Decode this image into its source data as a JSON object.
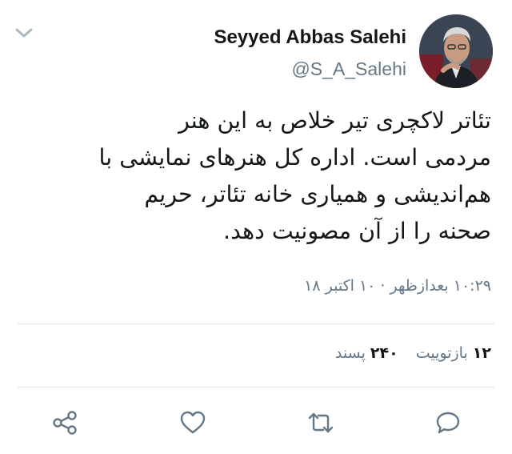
{
  "header": {
    "display_name": "Seyyed Abbas Salehi",
    "handle": "@S_A_Salehi",
    "menu_icon": "chevron-down-icon",
    "avatar": "profile-photo"
  },
  "tweet": {
    "lines": [
      "تئاتر لاکچری تیر خلاص به این هنر",
      "مردمی است. اداره کل هنرهای نمایشی با",
      "هم‌اندیشی و همیاری  خانه تئاتر، حریم",
      "صحنه را از آن مصونیت دهد."
    ],
    "timestamp": "۱۰:۲۹ بعدازظهر · ۱۰ اکتبر ۱۸"
  },
  "stats": {
    "retweets_count": "۱۲",
    "retweets_label": "بازتوییت",
    "likes_count": "۲۴۰",
    "likes_label": "پسند"
  },
  "actions": {
    "icons": [
      "share-icon",
      "like-icon",
      "retweet-icon",
      "reply-icon"
    ],
    "color": "#657786"
  }
}
